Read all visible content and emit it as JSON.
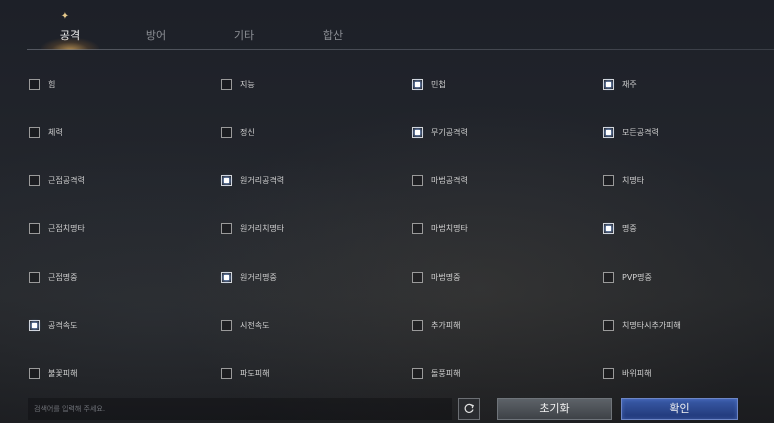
{
  "tabs": [
    {
      "label": "공격",
      "active": true
    },
    {
      "label": "방어",
      "active": false
    },
    {
      "label": "기타",
      "active": false
    },
    {
      "label": "합산",
      "active": false
    }
  ],
  "options": [
    {
      "label": "힘",
      "checked": false
    },
    {
      "label": "지능",
      "checked": false
    },
    {
      "label": "민첩",
      "checked": true
    },
    {
      "label": "재주",
      "checked": true
    },
    {
      "label": "체력",
      "checked": false
    },
    {
      "label": "정신",
      "checked": false
    },
    {
      "label": "무기공격력",
      "checked": true
    },
    {
      "label": "모든공격력",
      "checked": true
    },
    {
      "label": "근접공격력",
      "checked": false
    },
    {
      "label": "원거리공격력",
      "checked": true
    },
    {
      "label": "마법공격력",
      "checked": false
    },
    {
      "label": "치명타",
      "checked": false
    },
    {
      "label": "근접치명타",
      "checked": false
    },
    {
      "label": "원거리치명타",
      "checked": false
    },
    {
      "label": "마법치명타",
      "checked": false
    },
    {
      "label": "명중",
      "checked": true
    },
    {
      "label": "근접명중",
      "checked": false
    },
    {
      "label": "원거리명중",
      "checked": true
    },
    {
      "label": "마법명중",
      "checked": false
    },
    {
      "label": "PVP명중",
      "checked": false
    },
    {
      "label": "공격속도",
      "checked": true
    },
    {
      "label": "시전속도",
      "checked": false
    },
    {
      "label": "추가피해",
      "checked": false
    },
    {
      "label": "치명타시추가피해",
      "checked": false
    },
    {
      "label": "불꽃피해",
      "checked": false
    },
    {
      "label": "파도피해",
      "checked": false
    },
    {
      "label": "돌풍피해",
      "checked": false
    },
    {
      "label": "바위피해",
      "checked": false
    }
  ],
  "search": {
    "placeholder": "검색어를 입력해 주세요.",
    "value": ""
  },
  "buttons": {
    "reset_icon": "refresh-icon",
    "init_label": "초기화",
    "ok_label": "확인"
  },
  "colors": {
    "accent_gold": "#e7c98c",
    "confirm_blue": "#2b4a92",
    "check_glow": "#96beff"
  }
}
